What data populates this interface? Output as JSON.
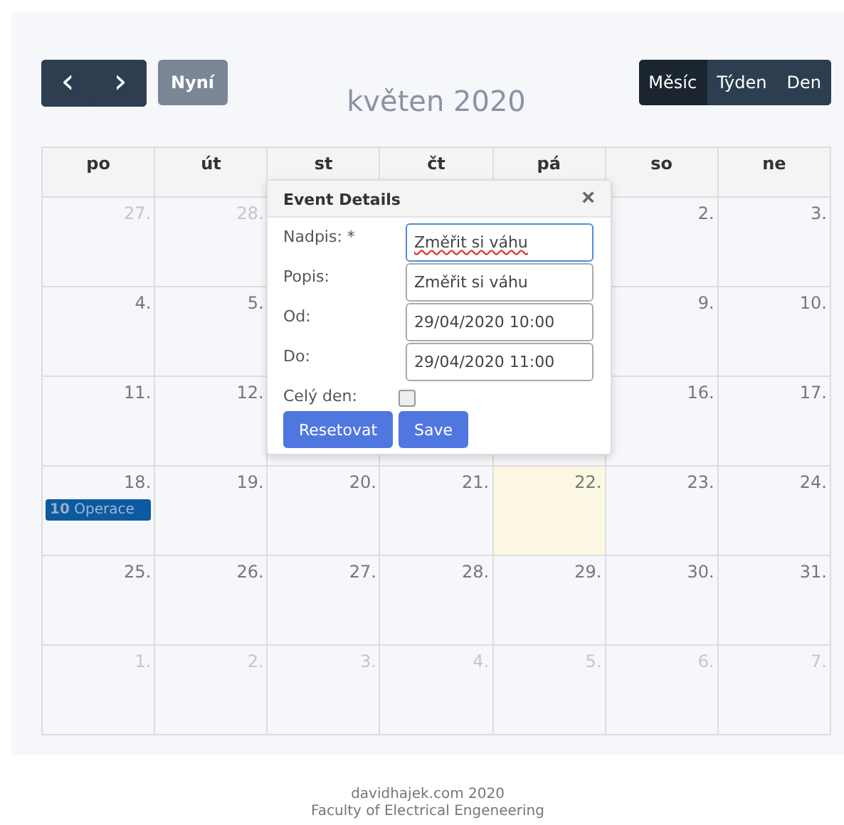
{
  "toolbar": {
    "prev": "‹",
    "next": "›",
    "today": "Nyní",
    "title": "květen 2020",
    "views": [
      {
        "label": "Měsíc",
        "selected": true
      },
      {
        "label": "Týden",
        "selected": false
      },
      {
        "label": "Den",
        "selected": false
      }
    ]
  },
  "calendar": {
    "weekdays": [
      "po",
      "út",
      "st",
      "čt",
      "pá",
      "so",
      "ne"
    ],
    "weeks": [
      {
        "left_of_dialog": [
          {
            "date": "27.",
            "other_month": true
          },
          {
            "date": "28.",
            "other_month": true
          }
        ],
        "right_of_dialog": [
          {
            "date": "2.",
            "other_month": false
          },
          {
            "date": "3.",
            "other_month": false
          }
        ]
      },
      {
        "left_of_dialog": [
          {
            "date": "4.",
            "other_month": false
          },
          {
            "date": "5.",
            "other_month": false
          }
        ],
        "right_of_dialog": [
          {
            "date": "9.",
            "other_month": false
          },
          {
            "date": "10.",
            "other_month": false
          }
        ]
      },
      {
        "left_of_dialog": [
          {
            "date": "11.",
            "other_month": false
          },
          {
            "date": "12.",
            "other_month": false
          }
        ],
        "right_of_dialog": [
          {
            "date": "16.",
            "other_month": false
          },
          {
            "date": "17.",
            "other_month": false
          }
        ]
      },
      [
        {
          "date": "18.",
          "other_month": false,
          "events": [
            {
              "text": "**10** Operace"
            }
          ]
        },
        {
          "date": "19.",
          "other_month": false
        },
        {
          "date": "20.",
          "other_month": false
        },
        {
          "date": "21.",
          "other_month": false
        },
        {
          "date": "22.",
          "other_month": false,
          "today": true
        },
        {
          "date": "23.",
          "other_month": false
        },
        {
          "date": "24.",
          "other_month": false
        }
      ],
      [
        {
          "date": "25.",
          "other_month": false
        },
        {
          "date": "26.",
          "other_month": false
        },
        {
          "date": "27.",
          "other_month": false
        },
        {
          "date": "28.",
          "other_month": false
        },
        {
          "date": "29.",
          "other_month": false
        },
        {
          "date": "30.",
          "other_month": false
        },
        {
          "date": "31.",
          "other_month": false
        }
      ],
      [
        {
          "date": "1.",
          "other_month": true
        },
        {
          "date": "2.",
          "other_month": true
        },
        {
          "date": "3.",
          "other_month": true
        },
        {
          "date": "4.",
          "other_month": true
        },
        {
          "date": "5.",
          "other_month": true
        },
        {
          "date": "6.",
          "other_month": true
        },
        {
          "date": "7.",
          "other_month": true
        }
      ]
    ]
  },
  "dialog": {
    "title": "Event Details",
    "close": "×",
    "fields": [
      {
        "kind": "text",
        "label": "Nadpis: *",
        "value": "Změřit si váhu",
        "focused": true,
        "misspelled": true
      },
      {
        "kind": "text",
        "label": "Popis:",
        "value": "Změřit si váhu",
        "focused": false,
        "misspelled": false
      },
      {
        "kind": "text",
        "label": "Od:",
        "value": "29/04/2020 10:00",
        "focused": false,
        "misspelled": false
      },
      {
        "kind": "text",
        "label": "Do:",
        "value": "29/04/2020 11:00",
        "focused": false,
        "misspelled": false
      },
      {
        "kind": "checkbox",
        "label": "Celý den:",
        "checked": false
      }
    ],
    "buttons": [
      "Resetovat",
      "Save"
    ]
  },
  "footer": [
    "davidhajek.com 2020",
    "Faculty of Electrical Engeneering"
  ]
}
